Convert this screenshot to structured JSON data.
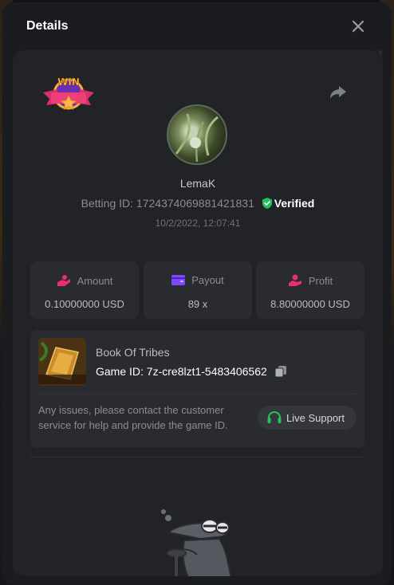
{
  "modal": {
    "title": "Details"
  },
  "bet": {
    "username": "LemaK",
    "betting_id_label": "Betting ID:",
    "betting_id": "1724374069881421831",
    "verified_label": "Verified",
    "datetime": "10/2/2022, 12:07:41",
    "badge_text": "WIN"
  },
  "stats": [
    {
      "label": "Amount",
      "value": "0.10000000 USD",
      "icon": "coin-hand-icon"
    },
    {
      "label": "Payout",
      "value": "89 x",
      "icon": "wallet-icon"
    },
    {
      "label": "Profit",
      "value": "8.80000000 USD",
      "icon": "profit-hand-icon"
    }
  ],
  "game": {
    "name": "Book Of Tribes",
    "id_label": "Game ID:",
    "id": "7z-cre8lzt1-5483406562",
    "help_text": "Any issues, please contact the customer service for help and provide the game ID.",
    "support_label": "Live Support"
  },
  "colors": {
    "accent_pink": "#e8306b",
    "accent_purple": "#7b4cff",
    "verified_green": "#23c25a",
    "support_green": "#23c25a"
  }
}
